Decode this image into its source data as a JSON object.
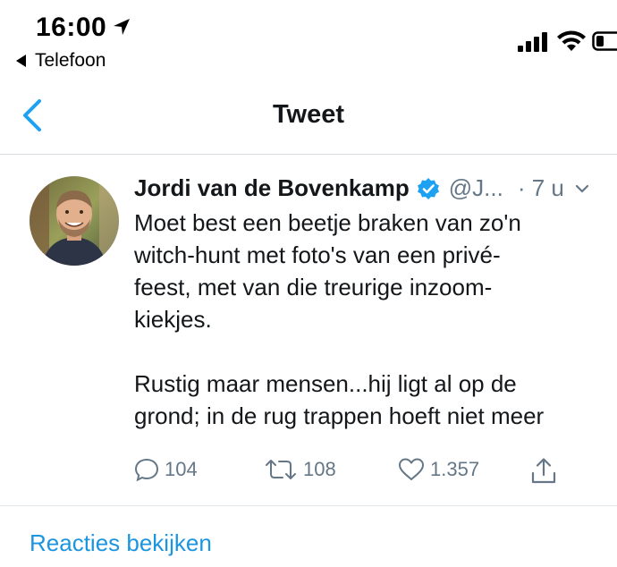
{
  "status_bar": {
    "time": "16:00",
    "back_app": "Telefoon",
    "location_icon": "location-arrow-icon",
    "signal_icon": "cellular-signal-icon",
    "wifi_icon": "wifi-icon",
    "battery_icon": "battery-icon"
  },
  "nav": {
    "back_icon": "chevron-left-icon",
    "title": "Tweet"
  },
  "tweet": {
    "avatar": "avatar",
    "display_name": "Jordi van de Bovenkamp",
    "verified_icon": "verified-badge-icon",
    "handle": "@J...",
    "time": "· 7 u",
    "text": "Moet best een beetje braken van zo'n\nwitch-hunt met foto's van een privé-\nfeest, met van die treurige inzoom-\nkiekjes.\n\nRustig maar mensen...hij ligt al op de\ngrond; in de rug trappen hoeft niet meer",
    "actions": {
      "reply_count": "104",
      "retweet_count": "108",
      "like_count": "1.357"
    }
  },
  "view_replies": "Reacties bekijken",
  "colors": {
    "accent": "#1da1f2",
    "link": "#1b95e0",
    "muted": "#657786",
    "text": "#14171a"
  }
}
